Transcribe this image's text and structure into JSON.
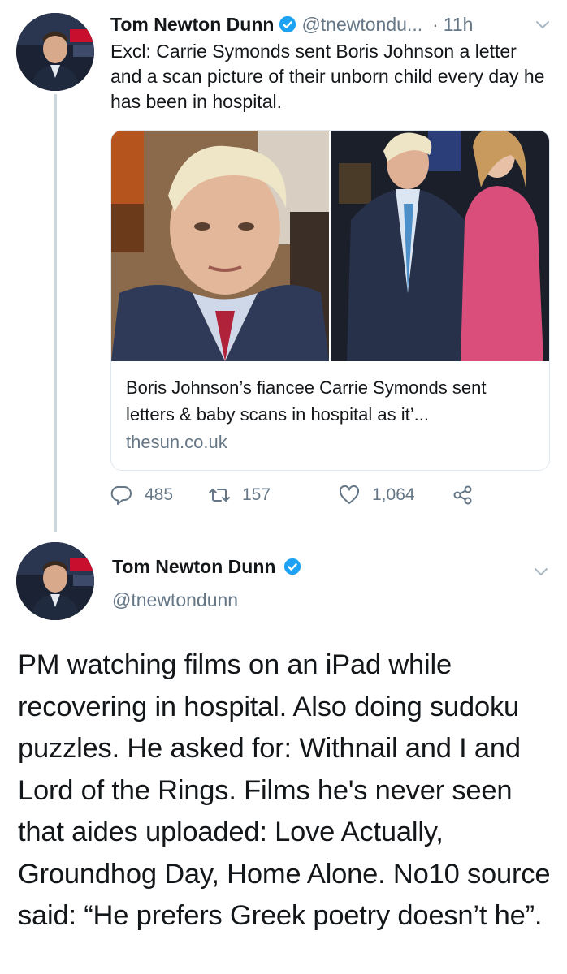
{
  "colors": {
    "accent": "#1da1f2",
    "text": "#14171a",
    "secondary": "#657786",
    "border": "#e1e8ed",
    "thread_line": "#ccd6dd"
  },
  "tweet1": {
    "author_name": "Tom Newton Dunn",
    "handle": "@tnewtondu...",
    "separator": "·",
    "time": "11h",
    "text": "Excl: Carrie Symonds sent Boris Johnson a letter and a scan picture of their unborn child every day he has been in hospital.",
    "card": {
      "title": "Boris Johnson’s fiancee Carrie Symonds sent letters & baby scans in hospital as it’...",
      "domain": "thesun.co.uk"
    },
    "actions": {
      "replies": "485",
      "retweets": "157",
      "likes": "1,064"
    },
    "icons": [
      "verified-badge-icon",
      "chevron-down-icon",
      "reply-icon",
      "retweet-icon",
      "like-icon",
      "share-icon"
    ]
  },
  "tweet2": {
    "author_name": "Tom Newton Dunn",
    "handle": "@tnewtondunn",
    "text": "PM watching films on an iPad while recovering in hospital. Also doing sudoku puzzles. He asked for: Withnail and I and Lord of the Rings. Films he's never seen that aides uploaded: Love Actually, Groundhog Day, Home Alone. No10 source said: “He prefers Greek poetry doesn’t he”."
  }
}
